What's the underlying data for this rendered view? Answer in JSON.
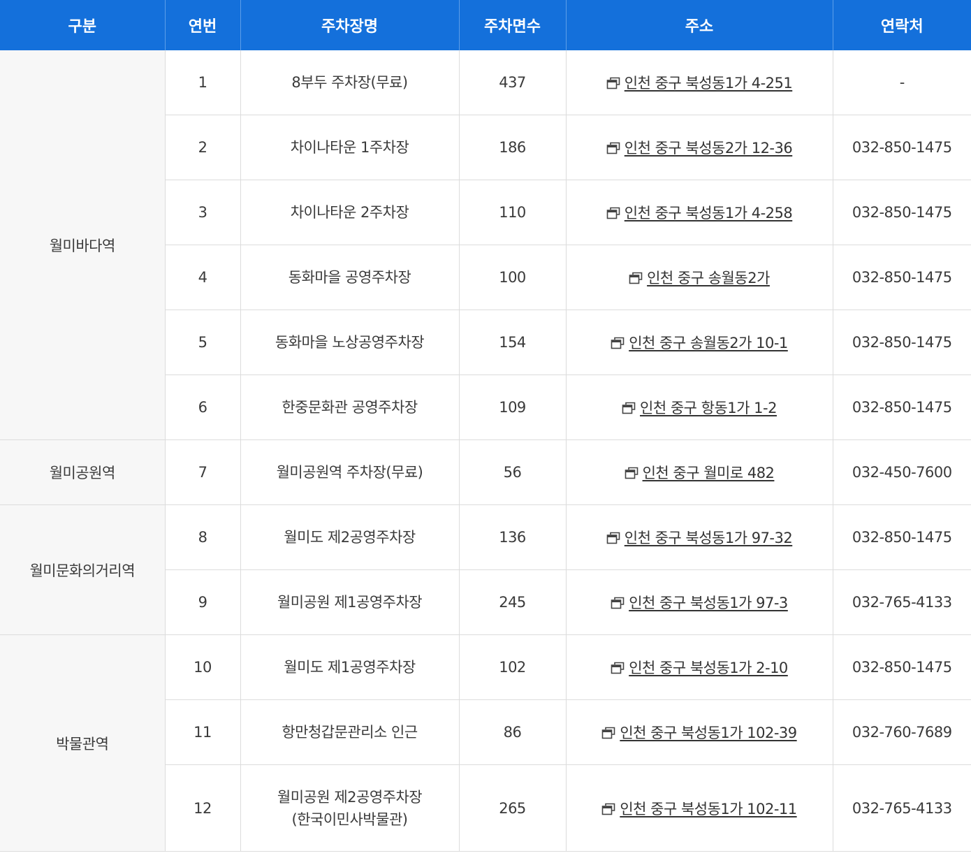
{
  "table": {
    "headers": {
      "group": "구분",
      "no": "연번",
      "name": "주차장명",
      "count": "주차면수",
      "address": "주소",
      "contact": "연락처"
    },
    "icon": "new-window-icon",
    "groups": [
      {
        "label": "월미바다역",
        "rows": [
          {
            "no": "1",
            "name": [
              "8부두 주차장(무료)"
            ],
            "count": "437",
            "address": "인천 중구 북성동1가 4-251",
            "contact": "-"
          },
          {
            "no": "2",
            "name": [
              "차이나타운 1주차장"
            ],
            "count": "186",
            "address": "인천 중구 북성동2가 12-36",
            "contact": "032-850-1475"
          },
          {
            "no": "3",
            "name": [
              "차이나타운 2주차장"
            ],
            "count": "110",
            "address": "인천 중구 북성동1가 4-258",
            "contact": "032-850-1475"
          },
          {
            "no": "4",
            "name": [
              "동화마을 공영주차장"
            ],
            "count": "100",
            "address": "인천 중구 송월동2가",
            "contact": "032-850-1475"
          },
          {
            "no": "5",
            "name": [
              "동화마을 노상공영주차장"
            ],
            "count": "154",
            "address": "인천 중구 송월동2가 10-1",
            "contact": "032-850-1475"
          },
          {
            "no": "6",
            "name": [
              "한중문화관 공영주차장"
            ],
            "count": "109",
            "address": "인천 중구 항동1가 1-2",
            "contact": "032-850-1475"
          }
        ]
      },
      {
        "label": "월미공원역",
        "rows": [
          {
            "no": "7",
            "name": [
              "월미공원역 주차장(무료)"
            ],
            "count": "56",
            "address": "인천 중구 월미로 482",
            "contact": "032-450-7600"
          }
        ]
      },
      {
        "label": "월미문화의거리역",
        "rows": [
          {
            "no": "8",
            "name": [
              "월미도 제2공영주차장"
            ],
            "count": "136",
            "address": "인천 중구 북성동1가 97-32",
            "contact": "032-850-1475"
          },
          {
            "no": "9",
            "name": [
              "월미공원 제1공영주차장"
            ],
            "count": "245",
            "address": "인천 중구 북성동1가 97-3",
            "contact": "032-765-4133"
          }
        ]
      },
      {
        "label": "박물관역",
        "rows": [
          {
            "no": "10",
            "name": [
              "월미도 제1공영주차장"
            ],
            "count": "102",
            "address": "인천 중구 북성동1가 2-10",
            "contact": "032-850-1475"
          },
          {
            "no": "11",
            "name": [
              "항만청갑문관리소 인근"
            ],
            "count": "86",
            "address": "인천 중구 북성동1가 102-39",
            "contact": "032-760-7689"
          },
          {
            "no": "12",
            "name": [
              "월미공원 제2공영주차장",
              "(한국이민사박물관)"
            ],
            "count": "265",
            "address": "인천 중구 북성동1가 102-11",
            "contact": "032-765-4133"
          }
        ]
      }
    ]
  }
}
